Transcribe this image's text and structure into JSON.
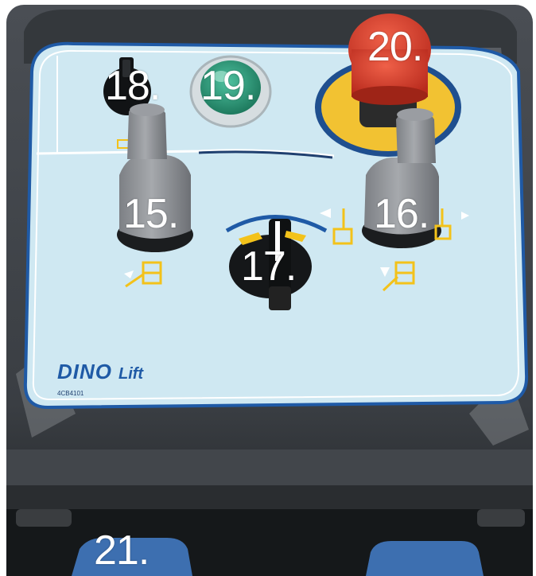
{
  "labels": {
    "l15": "15.",
    "l16": "16.",
    "l17": "17.",
    "l18": "18.",
    "l19": "19.",
    "l20": "20.",
    "l21": "21."
  },
  "panel": {
    "brand_main": "DINO",
    "brand_sub": "Lift",
    "code": "4CB4101"
  },
  "colors": {
    "panel": "#cfe8f2",
    "panel_border": "#1f5aa6",
    "housing": "#3b3f44",
    "emergency_red": "#d8402c",
    "emergency_yellow": "#f2c232",
    "lamp_green": "#2e9a7a",
    "joystick_grey": "#8e9196",
    "pictogram_yellow": "#f3c21a",
    "side_button_blue": "#3d6fb0"
  },
  "icons": [
    "stabilizer-out-icon",
    "stabilizer-in-icon",
    "lift-up-icon",
    "lift-down-icon",
    "rotate-icon"
  ]
}
